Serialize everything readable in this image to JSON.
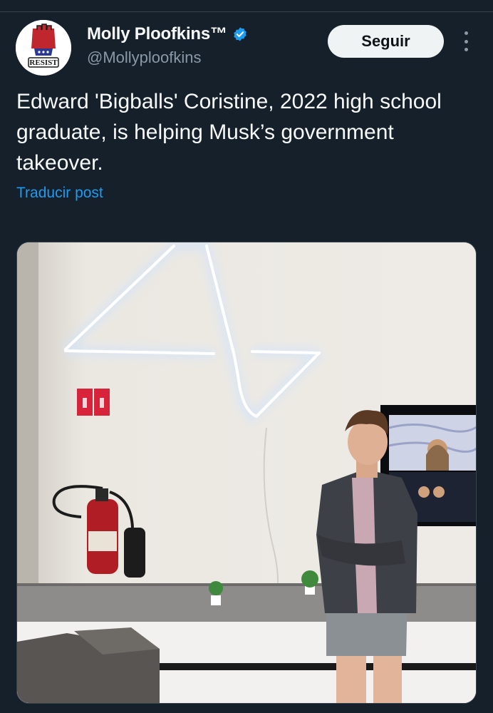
{
  "post": {
    "author": {
      "display_name": "Molly Ploofkins™",
      "handle": "@Mollyploofkins",
      "verified": true,
      "avatar_text": "RESIST"
    },
    "follow_label": "Seguir",
    "text": "Edward 'Bigballs' Coristine, 2022 high school\ngraduate, is helping Musk’s government\ntakeover.",
    "translate_label": "Traducir post",
    "media": {
      "type": "photo"
    }
  },
  "colors": {
    "background": "#15202b",
    "text_primary": "#f7f9f9",
    "text_secondary": "#8b98a5",
    "link": "#1d9bf0",
    "verified_badge": "#1d9bf0",
    "follow_button_bg": "#eff3f4"
  },
  "icons": [
    "verified-badge-icon",
    "more-options-icon"
  ]
}
